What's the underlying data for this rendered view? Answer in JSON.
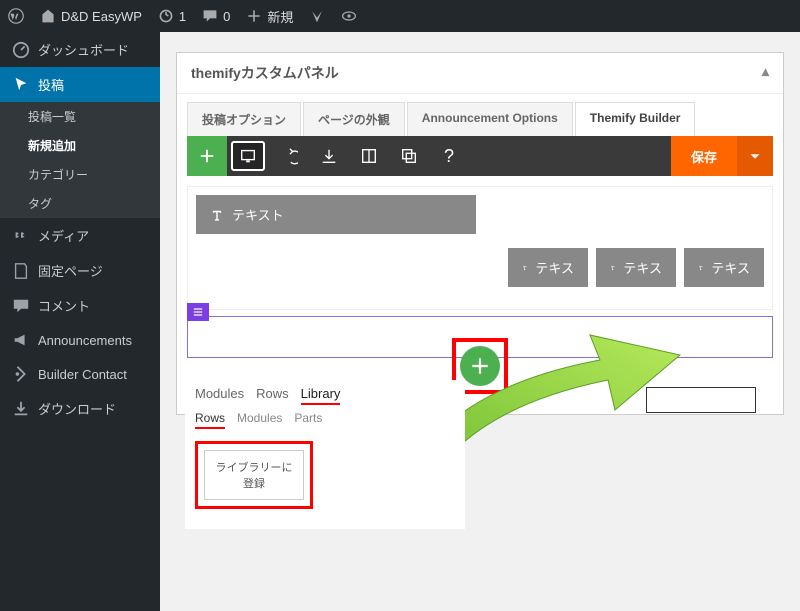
{
  "adminbar": {
    "site": "D&D EasyWP",
    "updates": "1",
    "comments": "0",
    "new": "新規"
  },
  "sidebar": {
    "dashboard": "ダッシュボード",
    "posts": "投稿",
    "posts_list": "投稿一覧",
    "posts_new": "新規追加",
    "categories": "カテゴリー",
    "tags": "タグ",
    "media": "メディア",
    "pages": "固定ページ",
    "comments": "コメント",
    "announcements": "Announcements",
    "builder_contact": "Builder Contact",
    "downloads": "ダウンロード"
  },
  "panel": {
    "title": "themifyカスタムパネル"
  },
  "tabs": {
    "post_options": "投稿オプション",
    "page_appearance": "ページの外観",
    "announcement": "Announcement Options",
    "themify": "Themify Builder"
  },
  "toolbar": {
    "help": "?",
    "save": "保存"
  },
  "modules": {
    "text_label": "テキスト",
    "text_short": "テキス"
  },
  "library": {
    "tab_modules": "Modules",
    "tab_rows": "Rows",
    "tab_library": "Library",
    "sub_rows": "Rows",
    "sub_modules": "Modules",
    "sub_parts": "Parts",
    "register": "ライブラリーに登録"
  }
}
